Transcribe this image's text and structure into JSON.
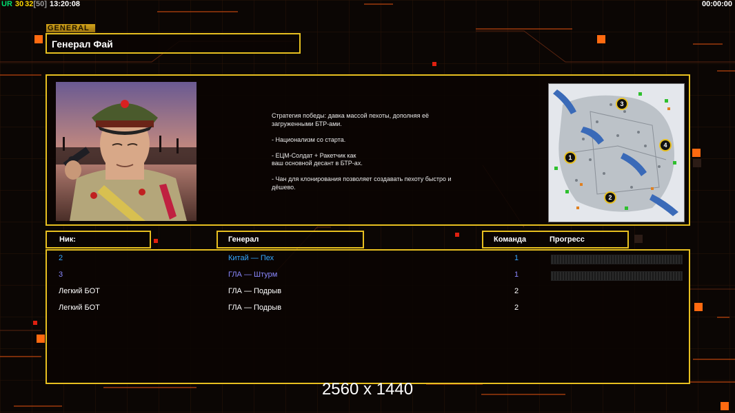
{
  "status": {
    "label_ur": "UR",
    "value1": "30",
    "value2": "32",
    "value3": "[50]",
    "clock": "13:20:08",
    "timer": "00:00:00",
    "colors": {
      "ur": "#00e070",
      "value1": "#ffd800",
      "value2": "#ffd800",
      "value3": "#9a9a9a"
    }
  },
  "general": {
    "tag": "GENERAL",
    "name": "Генерал Фай",
    "description": "Стратегия победы: давка массой пехоты, дополняя её\n загруженными БТР-ами.\n\n- Национализм со старта.\n\n- ЕЦМ-Солдат + Ракетчик как\nваш основной десант в БТР-ах.\n\n- Чан для клонирования позволяет создавать пехоту быстро и\n дёшево."
  },
  "minimap": {
    "spawns": [
      "1",
      "2",
      "3",
      "4"
    ]
  },
  "table": {
    "headers": {
      "nick": "Ник:",
      "general": "Генерал",
      "team": "Команда",
      "progress": "Прогресс"
    },
    "rows": [
      {
        "nick": "2",
        "general": "Китай — Пех",
        "team": "1",
        "color": "#35a8ff",
        "progress_visible": true,
        "progress": 0
      },
      {
        "nick": "3",
        "general": "ГЛА — Штурм",
        "team": "1",
        "color": "#8a88ff",
        "progress_visible": true,
        "progress": 0
      },
      {
        "nick": "Легкий БОТ",
        "general": "ГЛА — Подрыв",
        "team": "2",
        "color": "#ffffff",
        "progress_visible": false
      },
      {
        "nick": "Легкий БОТ",
        "general": "ГЛА — Подрыв",
        "team": "2",
        "color": "#ffffff",
        "progress_visible": false
      }
    ]
  },
  "resolution": "2560 x 1440",
  "theme": {
    "accent": "#e8c020",
    "ember": "#ff5a10",
    "background": "#0b0604"
  }
}
